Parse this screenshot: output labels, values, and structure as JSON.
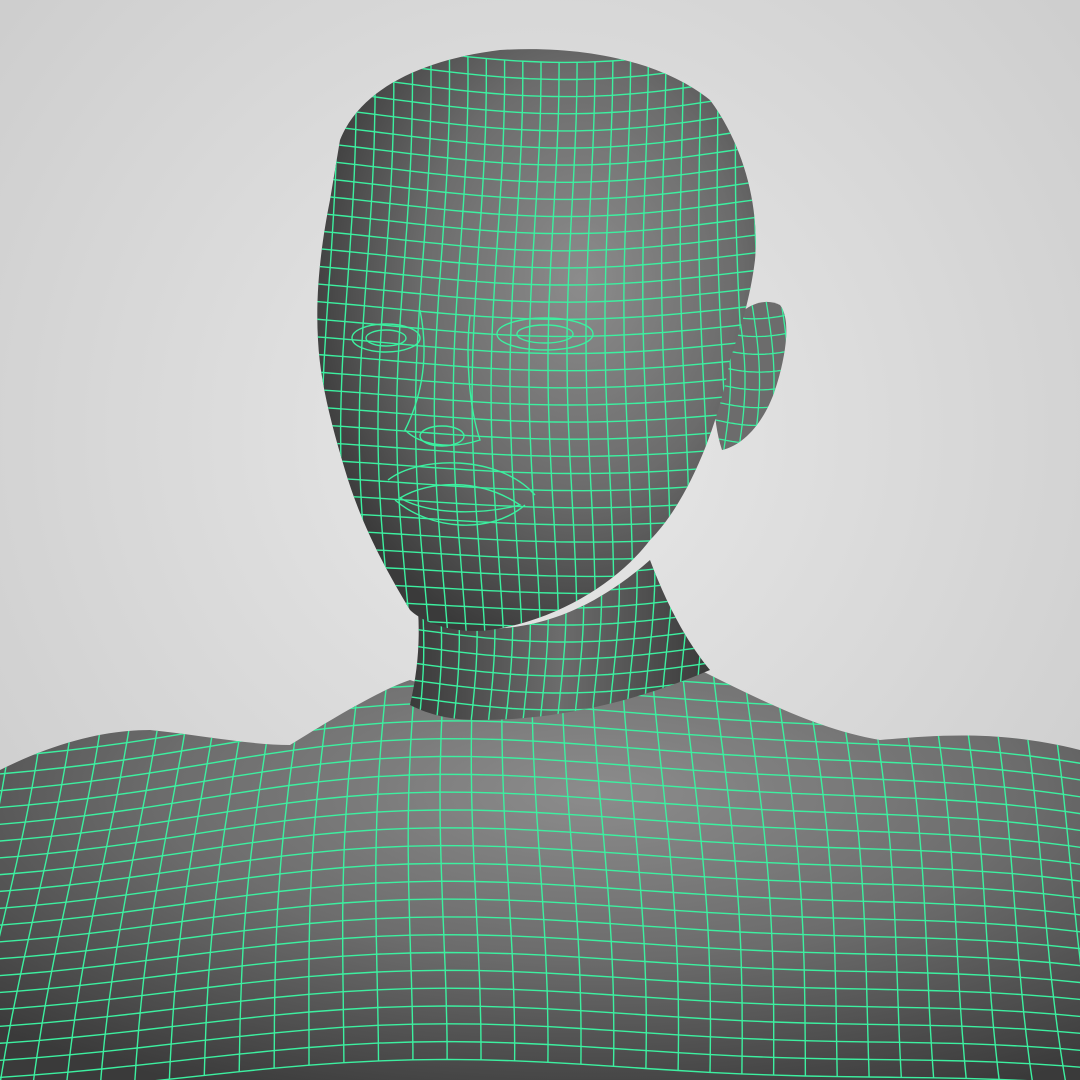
{
  "scene": {
    "subject": "wireframe-head-and-torso",
    "colors": {
      "background_light": "#e8e8e8",
      "background_dark": "#c9c9c9",
      "surface_light": "#8c8c8c",
      "surface_mid": "#6c6c6c",
      "surface_dark": "#3a3a3a",
      "wireframe": "#3cf0a0"
    }
  }
}
